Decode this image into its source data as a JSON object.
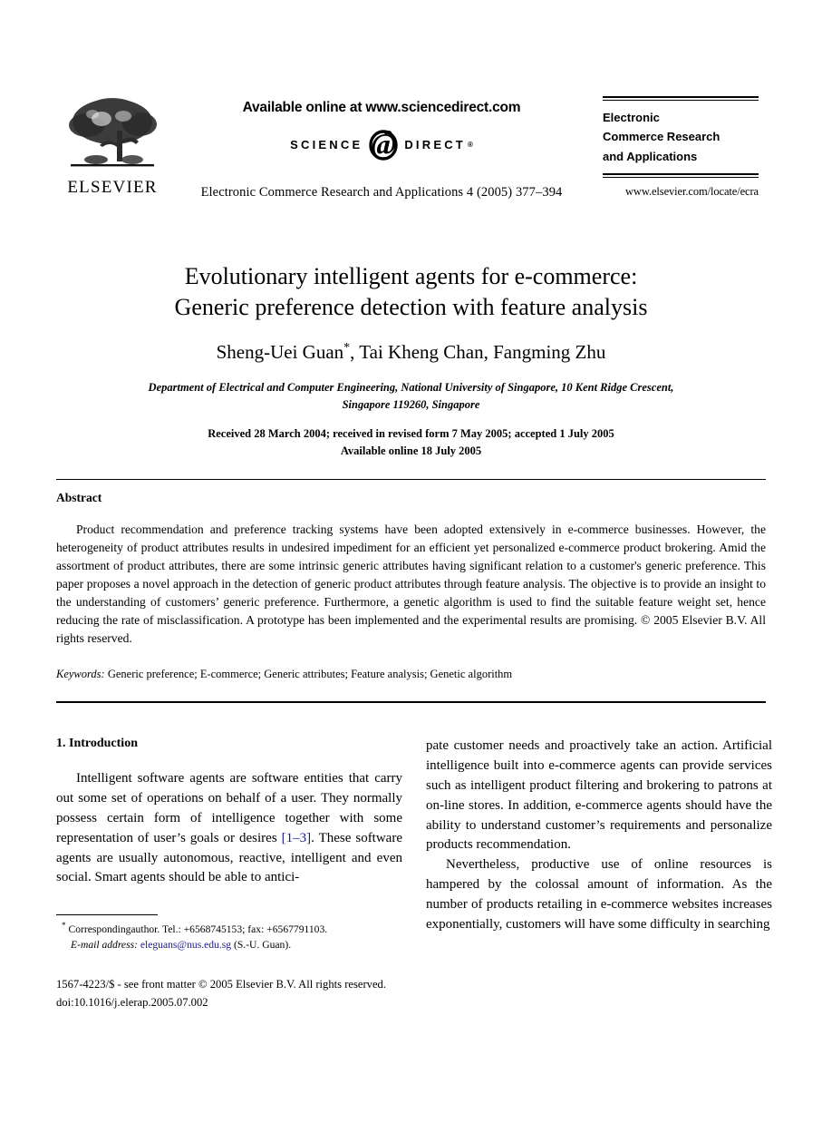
{
  "publisher": {
    "logo_name": "ELSEVIER",
    "tree_icon": "elsevier-tree-icon"
  },
  "sciencedirect": {
    "available_online": "Available online at www.sciencedirect.com",
    "word_left": "SCIENCE",
    "at_glyph": "@",
    "word_right": "DIRECT",
    "registered_mark": "®"
  },
  "journal": {
    "citation_line": "Electronic Commerce Research and Applications 4 (2005) 377–394",
    "title_line1": "Electronic",
    "title_line2": "Commerce Research",
    "title_line3": "and Applications",
    "url": "www.elsevier.com/locate/ecra"
  },
  "article": {
    "title_line1": "Evolutionary intelligent agents for e-commerce:",
    "title_line2": "Generic preference detection with feature analysis",
    "authors": "Sheng-Uei Guan",
    "corresponding_star": "*",
    "authors_rest": ", Tai Kheng Chan, Fangming Zhu",
    "affiliation_line1": "Department of Electrical and Computer Engineering, National University of Singapore, 10 Kent Ridge Crescent,",
    "affiliation_line2": "Singapore 119260, Singapore",
    "received_line": "Received 28 March 2004; received in revised form 7 May 2005; accepted 1 July 2005",
    "available_line": "Available online 18 July 2005"
  },
  "abstract": {
    "heading": "Abstract",
    "text": "Product recommendation and preference tracking systems have been adopted extensively in e-commerce businesses. However, the heterogeneity of product attributes results in undesired impediment for an efficient yet personalized e-commerce product brokering. Amid the assortment of product attributes, there are some intrinsic generic attributes having significant relation to a customer's generic preference. This paper proposes a novel approach in the detection of generic product attributes through feature analysis. The objective is to provide an insight to the understanding of customers’ generic preference. Furthermore, a genetic algorithm is used to find the suitable feature weight set, hence reducing the rate of misclassification. A prototype has been implemented and the experimental results are promising. © 2005 Elsevier B.V. All rights reserved."
  },
  "keywords": {
    "label": "Keywords:",
    "value": "Generic preference; E-commerce; Generic attributes; Feature analysis; Genetic algorithm"
  },
  "introduction": {
    "heading": "1. Introduction",
    "para1_a": "Intelligent software agents are software entities that carry out some set of operations on behalf of a user. They normally possess certain form of intelligence together with some representation of user’s goals or desires ",
    "para1_cite": "[1–3]",
    "para1_b": ". These software agents are usually autonomous, reactive, intelligent and even social. Smart agents should be able to antici-",
    "para2": "pate customer needs and proactively take an action. Artificial intelligence built into e-commerce agents can provide services such as intelligent product filtering and brokering to patrons at on-line stores. In addition, e-commerce agents should have the ability to understand customer’s requirements and personalize products recommendation.",
    "para3": "Nevertheless, productive use of online resources is hampered by the colossal amount of information. As the number of products retailing in e-commerce websites increases exponentially, customers will have some difficulty in searching"
  },
  "footnote": {
    "star": "*",
    "corresponding": "Correspondingauthor. Tel.: +6568745153; fax: +6567791103.",
    "email_label": "E-mail address:",
    "email": "eleguans@nus.edu.sg",
    "email_owner": "(S.-U. Guan)."
  },
  "footer": {
    "front_matter": "1567-4223/$ - see front matter © 2005 Elsevier B.V. All rights reserved.",
    "doi": "doi:10.1016/j.elerap.2005.07.002"
  },
  "colors": {
    "link": "#1a1a8c",
    "text": "#000000",
    "background": "#ffffff"
  }
}
